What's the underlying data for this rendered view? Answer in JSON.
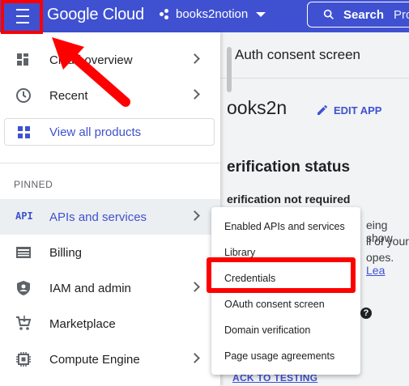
{
  "header": {
    "brand": "Google Cloud",
    "project": "books2notion",
    "search_label": "Search",
    "search_extra": "Pro"
  },
  "content": {
    "crumb": "Auth consent screen",
    "app_name": "ooks2n",
    "edit_label": "EDIT APP",
    "verification_title": "erification status",
    "not_required": "erification not required",
    "text1": "eing show",
    "text2": "ll of your",
    "text3_pre": "opes.",
    "text3_link": "Lea",
    "help": "?",
    "back": "ACK TO TESTING"
  },
  "sidebar": {
    "items": [
      {
        "label": "Cloud overview",
        "icon": "dashboard-icon"
      },
      {
        "label": "Recent",
        "icon": "clock-icon"
      }
    ],
    "view_all": "View all products",
    "pinned_label": "PINNED",
    "pinned": [
      {
        "label": "APIs and services",
        "icon": "api-icon",
        "icon_text": "API"
      },
      {
        "label": "Billing",
        "icon": "billing-icon"
      },
      {
        "label": "IAM and admin",
        "icon": "shield-icon"
      },
      {
        "label": "Marketplace",
        "icon": "cart-icon"
      },
      {
        "label": "Compute Engine",
        "icon": "chip-icon"
      }
    ]
  },
  "submenu": {
    "items": [
      "Enabled APIs and services",
      "Library",
      "Credentials",
      "OAuth consent screen",
      "Domain verification",
      "Page usage agreements"
    ]
  },
  "colors": {
    "accent": "#3f51d1",
    "annotation": "#ff0000"
  }
}
